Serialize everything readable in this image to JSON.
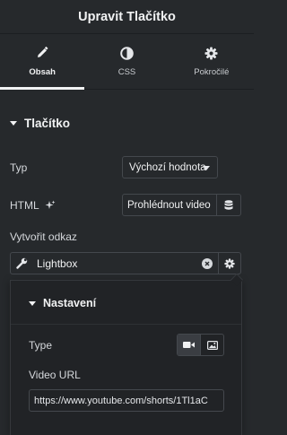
{
  "panel": {
    "title": "Upravit Tlačítko"
  },
  "tabs": [
    {
      "label": "Obsah",
      "icon": "pencil-icon",
      "active": true
    },
    {
      "label": "CSS",
      "icon": "half-circle-icon",
      "active": false
    },
    {
      "label": "Pokročilé",
      "icon": "gear-icon",
      "active": false
    }
  ],
  "section": {
    "title": "Tlačítko"
  },
  "fields": {
    "type_label": "Typ",
    "type_value": "Výchozí hodnota",
    "html_label": "HTML",
    "html_value": "Prohlédnout video",
    "link_label": "Vytvořit odkaz",
    "link_value": "Lightbox"
  },
  "popover": {
    "title": "Nastavení",
    "type_label": "Type",
    "type_options": [
      "video",
      "image"
    ],
    "type_selected": "video",
    "url_label": "Video URL",
    "url_value": "https://www.youtube.com/shorts/1Tl1aC"
  },
  "colors": {
    "background": "#26292c",
    "border": "#44484d",
    "text": "#f1f2f3"
  }
}
